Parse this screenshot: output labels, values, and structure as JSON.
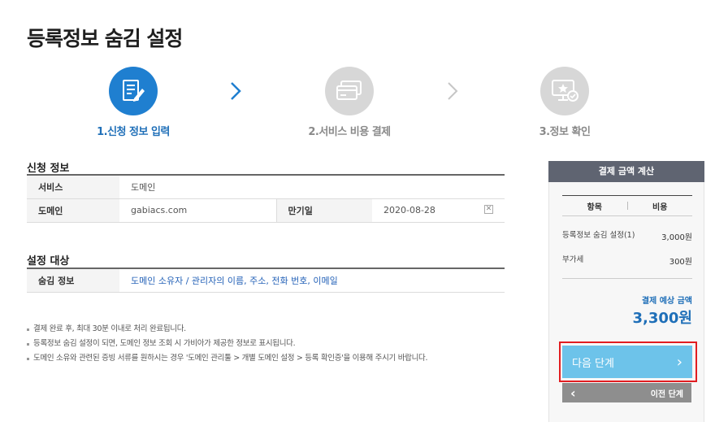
{
  "page": {
    "title": "등록정보 숨김 설정"
  },
  "steps": [
    {
      "number": "1.",
      "label": "신청 정보 입력",
      "state": "active",
      "icon": "edit-form-icon"
    },
    {
      "number": "2.",
      "label": "서비스 비용 결제",
      "state": "inactive",
      "icon": "credit-card-icon"
    },
    {
      "number": "3.",
      "label": "정보 확인",
      "state": "inactive",
      "icon": "monitor-star-icon"
    }
  ],
  "application": {
    "title": "신청 정보",
    "service_label": "서비스",
    "service_value": "도메인",
    "domain_label": "도메인",
    "domain_value": "gabiacs.com",
    "expiry_label": "만기일",
    "expiry_value": "2020-08-28",
    "clear_symbol": "✕"
  },
  "target": {
    "title": "설정 대상",
    "hidden_label": "숨김 정보",
    "hidden_value": "도메인 소유자 / 관리자의 이름, 주소, 전화 번호, 이메일"
  },
  "notes": [
    "결제 완료 후, 최대 30분 이내로 처리 완료됩니다.",
    "등록정보 숨김 설정이 되면, 도메인 정보 조회 시 가비아가 제공한 정보로 표시됩니다.",
    "도메인 소유와 관련된 증빙 서류를 원하시는 경우 '도메인 관리툴 > 개별 도메인 설정 > 등록 확인증'을 이용해 주시기 바랍니다."
  ],
  "calc": {
    "title": "결제 금액 계산",
    "col_item": "항목",
    "col_cost": "비용",
    "rows": [
      {
        "label": "등록정보 숨김 설정(1)",
        "amount": "3,000원"
      },
      {
        "label": "부가세",
        "amount": "300원"
      }
    ],
    "total_label": "결제 예상 금액",
    "total_value": "3,300원"
  },
  "buttons": {
    "next_label": "다음 단계",
    "next_arrow": "›",
    "prev_label": "이전 단계",
    "prev_arrow": "‹"
  },
  "colors": {
    "accent": "#1f7fd0",
    "button_next": "#6dc3ea",
    "highlight": "#e11d21"
  }
}
